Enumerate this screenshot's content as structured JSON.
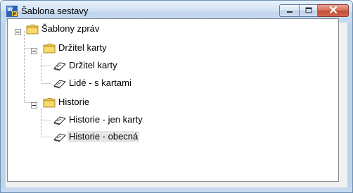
{
  "window": {
    "title": "Šablona sestavy",
    "icon": "report-app-icon",
    "buttons": [
      "minimize-icon",
      "maximize-icon",
      "close-icon"
    ]
  },
  "tree": {
    "root": {
      "label": "Šablony zpráv",
      "expanded": true,
      "children": [
        {
          "label": "Držitel karty",
          "expanded": true,
          "children": [
            {
              "label": "Držitel karty"
            },
            {
              "label": "Lidé - s kartami"
            }
          ]
        },
        {
          "label": "Historie",
          "expanded": true,
          "children": [
            {
              "label": "Historie - jen karty"
            },
            {
              "label": "Historie - obecná",
              "selected": true
            }
          ]
        }
      ]
    }
  },
  "colors": {
    "folder": "#f2c94c",
    "selected_bg": "#e6e6e6",
    "close_button": "#c94f3b"
  }
}
